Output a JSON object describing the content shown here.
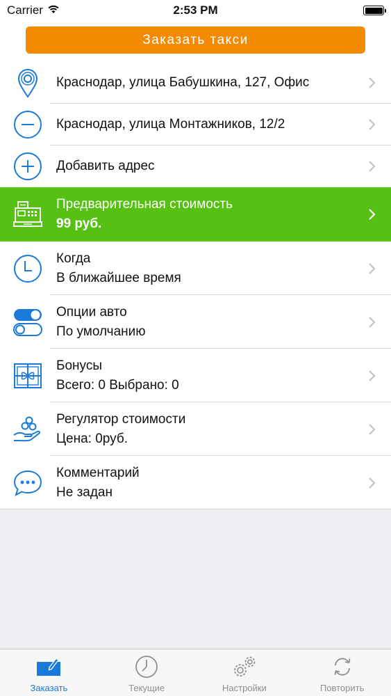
{
  "status_bar": {
    "carrier": "Carrier",
    "time": "2:53 PM"
  },
  "order_button": {
    "label": "Заказать такси",
    "color": "#f38a00"
  },
  "rows": [
    {
      "icon": "location-pin-icon",
      "line1": "Краснодар, улица Бабушкина, 127, Офис"
    },
    {
      "icon": "minus-circle-icon",
      "line1": "Краснодар, улица Монтажников, 12/2"
    },
    {
      "icon": "plus-circle-icon",
      "line1": "Добавить адрес"
    },
    {
      "icon": "cash-register-icon",
      "line1": "Предварительная стоимость",
      "line2": "99 руб.",
      "highlight_color": "#56c013"
    },
    {
      "icon": "clock-icon",
      "line1": "Когда",
      "line2": "В ближайшее время"
    },
    {
      "icon": "toggles-icon",
      "line1": "Опции авто",
      "line2": "По умолчанию"
    },
    {
      "icon": "gift-icon",
      "line1": "Бонусы",
      "line2": "Всего: 0 Выбрано: 0"
    },
    {
      "icon": "hand-coins-icon",
      "line1": "Регулятор стоимости",
      "line2": "Цена: 0руб."
    },
    {
      "icon": "chat-bubble-icon",
      "line1": "Комментарий",
      "line2": "Не задан"
    }
  ],
  "tabs": [
    {
      "label": "Заказать",
      "icon": "order-pencil-icon",
      "active": true
    },
    {
      "label": "Текущие",
      "icon": "clock-icon",
      "active": false
    },
    {
      "label": "Настройки",
      "icon": "gears-icon",
      "active": false
    },
    {
      "label": "Повторить",
      "icon": "repeat-icon",
      "active": false
    }
  ],
  "colors": {
    "accent_blue": "#1a7ad9",
    "green": "#56c013",
    "orange": "#f38a00"
  }
}
